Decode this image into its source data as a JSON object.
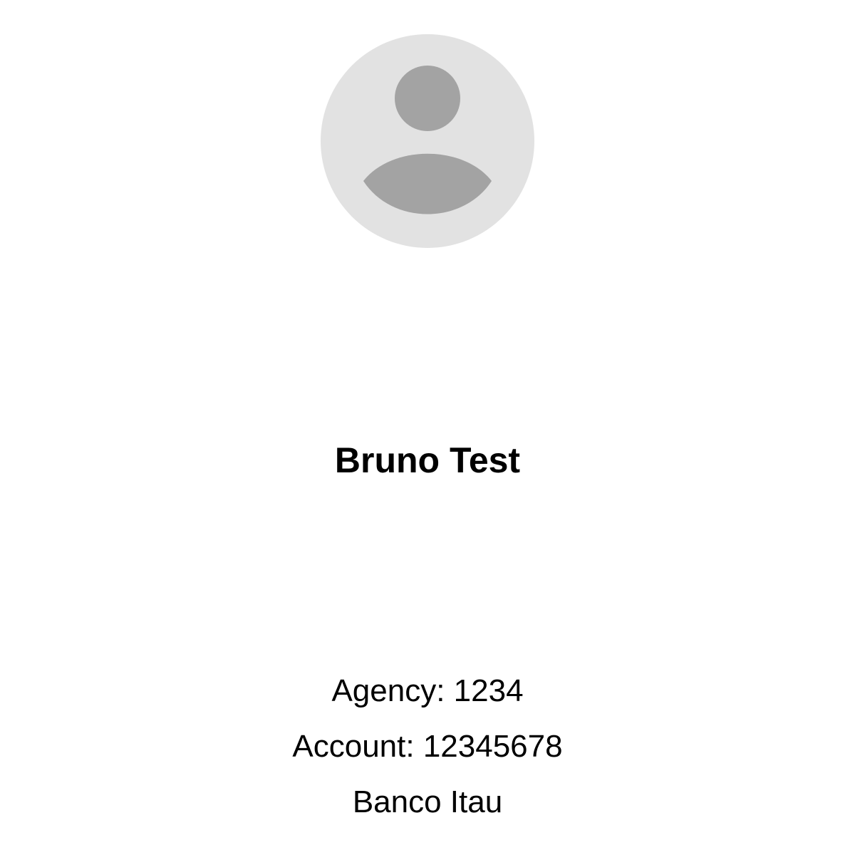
{
  "profile": {
    "avatar_icon": "default-user-avatar-icon",
    "name": "Bruno Test",
    "agency": "Agency: 1234",
    "account": "Account: 12345678",
    "bank": "Banco Itau"
  },
  "colors": {
    "avatar_background": "#e2e2e2",
    "avatar_figure": "#a3a3a3",
    "text": "#000000",
    "page_background": "#ffffff"
  }
}
